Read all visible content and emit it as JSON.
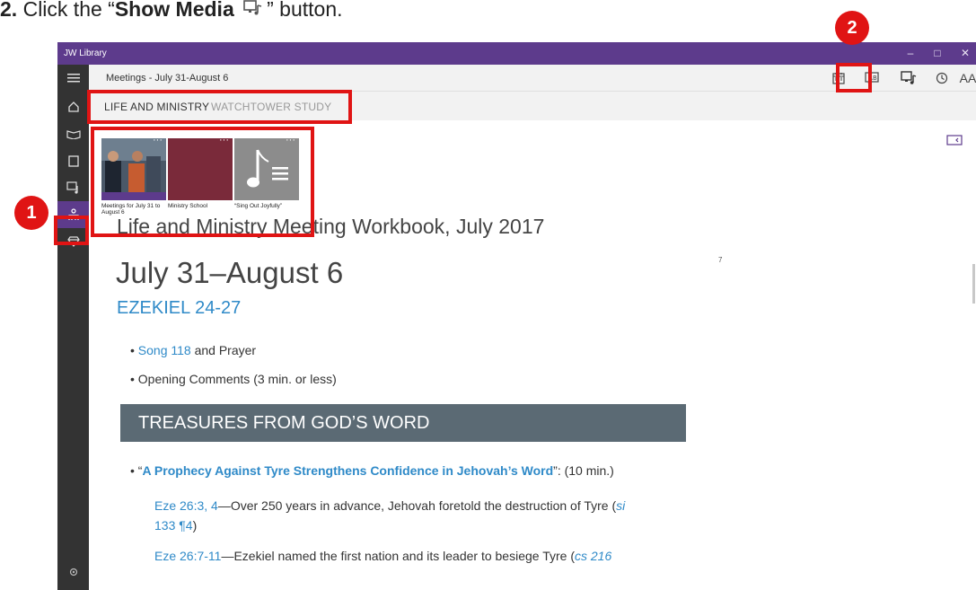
{
  "instruction": {
    "number": "2.",
    "prefix": "Click the “",
    "button_name": "Show Media",
    "suffix": "” button."
  },
  "window": {
    "app_title": "JW Library",
    "minimize": "–",
    "maximize": "□",
    "close": "✕"
  },
  "header": {
    "crumb": "Meetings - July 31-August 6",
    "font_size_label": "AA",
    "more_label": "···"
  },
  "tabs": [
    {
      "label": "LIFE AND MINISTRY",
      "active": true
    },
    {
      "label": "WATCHTOWER STUDY",
      "active": false
    }
  ],
  "media": [
    {
      "label": "Meetings for July 31 to August 6",
      "icon": "photo-thumb"
    },
    {
      "label": "Ministry School",
      "icon": "maroon-thumb"
    },
    {
      "label": "“Sing Out Joyfully”",
      "icon": "music-note-icon"
    }
  ],
  "article": {
    "workbook": "Life and Ministry Meeting Workbook, July 2017",
    "week": "July 31–August 6",
    "reading": "EZEKIEL 24-27",
    "margin_number": "7",
    "song_link": "Song 118",
    "song_rest": " and Prayer",
    "opening": "Opening Comments (3 min. or less)",
    "section": "TREASURES FROM GOD’S WORD",
    "talk_title": "A Prophecy Against Tyre Strengthens Confidence in Jehovah’s Word",
    "talk_time": ": (10 min.)",
    "p1_ref": "Eze 26:3, 4",
    "p1_text": "—Over 250 years in advance, Jehovah foretold the destruction of Tyre (",
    "p1_cite": "si",
    "p1_cite_rest": "133 ¶4",
    "p1_close": ")",
    "p2_ref": "Eze 26:7-11",
    "p2_text": "—Ezekiel named the first nation and its leader to besiege Tyre (",
    "p2_cite": "cs 216"
  },
  "callouts": [
    {
      "number": "1"
    },
    {
      "number": "2"
    }
  ],
  "colors": {
    "accent": "#5d3b8c",
    "sidebar": "#333333",
    "link": "#2f8ac8",
    "banner": "#5b6a74",
    "callout": "#e01414"
  }
}
